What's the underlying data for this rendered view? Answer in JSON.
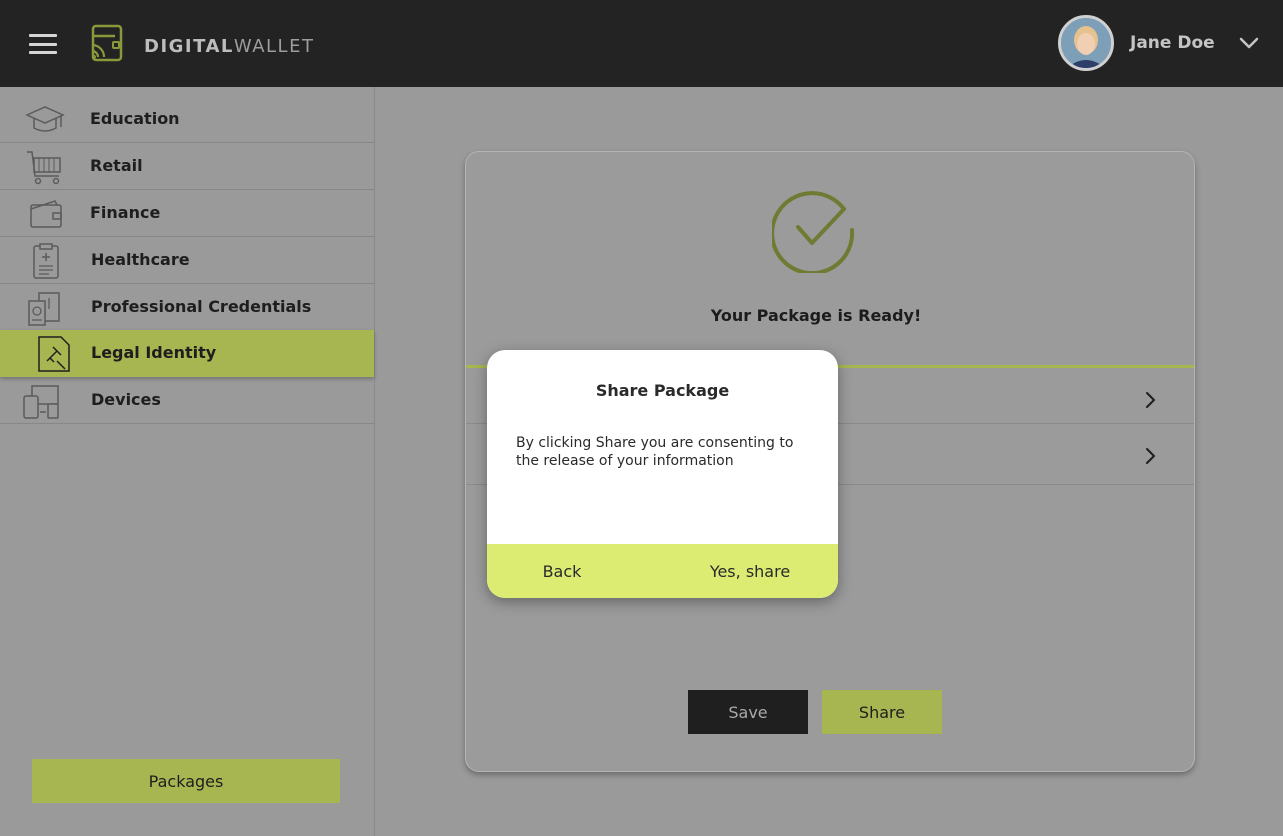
{
  "header": {
    "brand_bold": "DIGITAL",
    "brand_light": "WALLET",
    "user_name": "Jane Doe",
    "menu_icon": "hamburger-menu-icon",
    "logo_icon": "wallet-contactless-icon",
    "user_menu_icon": "chevron-down-icon"
  },
  "sidebar": {
    "items": [
      {
        "label": "Education",
        "icon": "graduation-cap-icon",
        "active": false
      },
      {
        "label": "Retail",
        "icon": "shopping-cart-icon",
        "active": false
      },
      {
        "label": "Finance",
        "icon": "wallet-icon",
        "active": false
      },
      {
        "label": "Healthcare",
        "icon": "medical-clipboard-icon",
        "active": false
      },
      {
        "label": "Professional Credentials",
        "icon": "credential-badge-icon",
        "active": false
      },
      {
        "label": "Legal Identity",
        "icon": "gavel-document-icon",
        "active": true
      },
      {
        "label": "Devices",
        "icon": "devices-icon",
        "active": false
      }
    ],
    "packages_label": "Packages"
  },
  "card": {
    "title": "Your Package is Ready!",
    "save_label": "Save",
    "share_label": "Share",
    "check_icon": "check-circle-icon"
  },
  "modal": {
    "title": "Share Package",
    "body": "By clicking Share you are consenting to the release of your information",
    "back_label": "Back",
    "confirm_label": "Yes, share"
  },
  "colors": {
    "header_bg": "#232323",
    "accent": "#a8b651",
    "modal_footer": "#dcec73",
    "overlay": "#9a9a9a"
  }
}
